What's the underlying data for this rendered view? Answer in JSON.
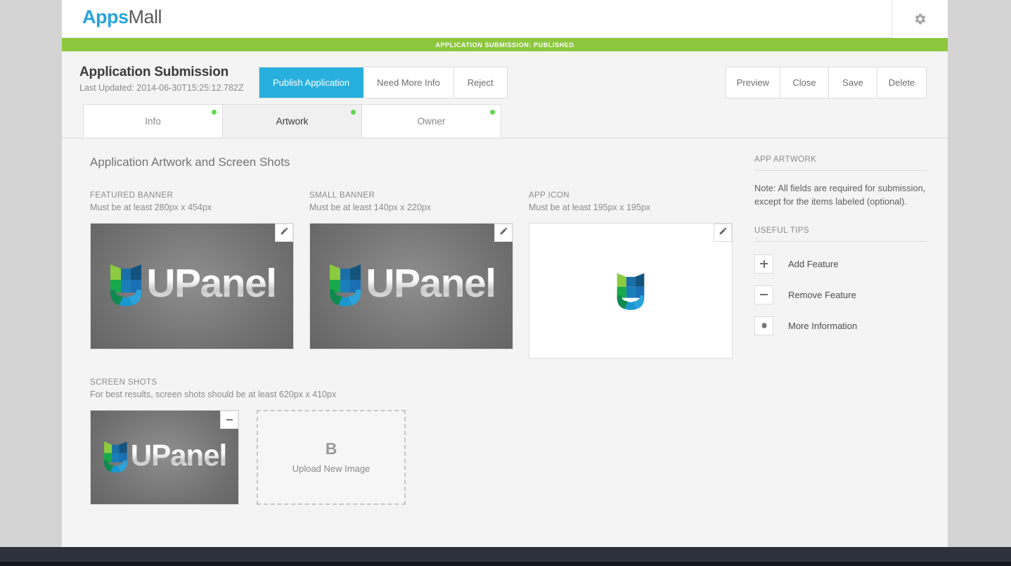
{
  "header": {
    "brand_apps": "Apps",
    "brand_mall": "Mall",
    "gear_icon": "gear-icon"
  },
  "status_bar": {
    "text": "APPLICATION SUBMISSION: PUBLISHED",
    "color": "#8dc63f"
  },
  "titlebar": {
    "title": "Application Submission",
    "subtitle": "Last Updated: 2014-06-30T15:25:12.782Z",
    "actions": [
      {
        "label": "Publish Application",
        "active": true
      },
      {
        "label": "Need More Info",
        "active": false
      },
      {
        "label": "Reject",
        "active": false
      }
    ],
    "right_actions": [
      {
        "label": "Preview"
      },
      {
        "label": "Close"
      },
      {
        "label": "Save"
      },
      {
        "label": "Delete"
      }
    ],
    "accent_color": "#27b0de"
  },
  "tabs": [
    {
      "label": "Info",
      "active": false,
      "status": "complete"
    },
    {
      "label": "Artwork",
      "active": true,
      "status": "complete"
    },
    {
      "label": "Owner",
      "active": false,
      "status": "complete"
    }
  ],
  "main": {
    "section_title": "Application Artwork and Screen Shots",
    "artwork": [
      {
        "label": "FEATURED BANNER",
        "requirement": "Must be at least 280px x 454px",
        "type": "banner",
        "image_alt": "UPanel",
        "edit_icon": "pencil-icon"
      },
      {
        "label": "SMALL BANNER",
        "requirement": "Must be at least 140px x 220px",
        "type": "banner",
        "image_alt": "UPanel",
        "edit_icon": "pencil-icon"
      },
      {
        "label": "APP ICON",
        "requirement": "Must be at least 195px x 195px",
        "type": "icon",
        "image_alt": "U",
        "edit_icon": "pencil-icon"
      }
    ],
    "screenshots": {
      "label": "SCREEN SHOTS",
      "requirement": "For best results, screen shots should be at least 620px x 410px",
      "items": [
        {
          "image_alt": "UPanel",
          "remove_icon": "minus-icon"
        }
      ],
      "upload": {
        "glyph": "B",
        "text": "Upload New Image"
      }
    }
  },
  "rail": {
    "heading": "APP ARTWORK",
    "note": "Note: All fields are required for submission, except for the items labeled (optional).",
    "tips_heading": "USEFUL TIPS",
    "tips": [
      {
        "icon": "plus-icon",
        "label": "Add Feature"
      },
      {
        "icon": "minus-icon",
        "label": "Remove Feature"
      },
      {
        "icon": "asterisk-icon",
        "label": "More Information"
      }
    ]
  }
}
